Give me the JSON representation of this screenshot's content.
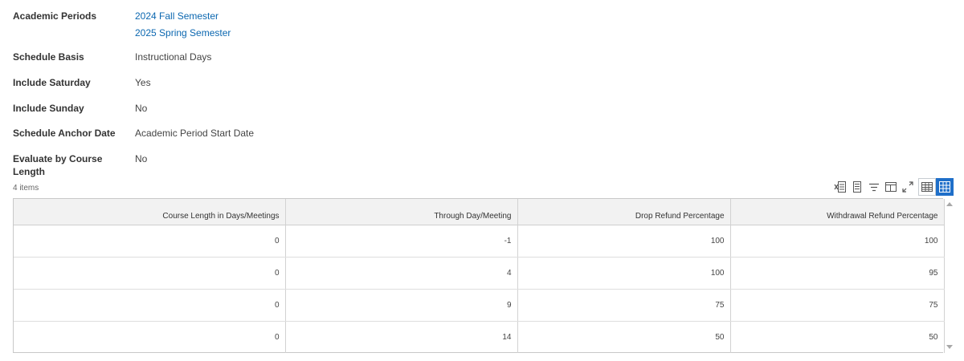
{
  "fields": {
    "academic_periods": {
      "label": "Academic Periods",
      "values": [
        "2024 Fall Semester",
        "2025 Spring Semester"
      ]
    },
    "schedule_basis": {
      "label": "Schedule Basis",
      "value": "Instructional Days"
    },
    "include_saturday": {
      "label": "Include Saturday",
      "value": "Yes"
    },
    "include_sunday": {
      "label": "Include Sunday",
      "value": "No"
    },
    "anchor_date": {
      "label": "Schedule Anchor Date",
      "value": "Academic Period Start Date"
    },
    "evaluate_length": {
      "label": "Evaluate by Course Length",
      "value": "No"
    }
  },
  "grid": {
    "count_label": "4 items",
    "toolbar_icons": [
      "export-to-excel-icon",
      "print-icon",
      "filter-icon",
      "column-chooser-icon",
      "fullscreen-icon"
    ],
    "view_icons": [
      "table-view-icon",
      "grid-view-icon"
    ],
    "columns": [
      "Course Length in Days/Meetings",
      "Through Day/Meeting",
      "Drop Refund Percentage",
      "Withdrawal Refund Percentage"
    ],
    "rows": [
      [
        "0",
        "-1",
        "100",
        "100"
      ],
      [
        "0",
        "4",
        "100",
        "95"
      ],
      [
        "0",
        "9",
        "75",
        "75"
      ],
      [
        "0",
        "14",
        "50",
        "50"
      ]
    ]
  },
  "colors": {
    "link": "#0b67b0",
    "active_view": "#1f6fc9",
    "header_bg": "#f2f2f2"
  }
}
